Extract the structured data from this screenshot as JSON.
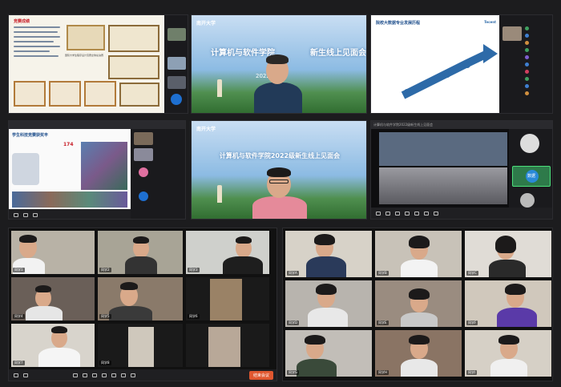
{
  "slide": {
    "school_logo": "南开大学",
    "event_title": "计算机与软件学院2022级新生线上见面会",
    "event_title_partial_left": "计算机与软件学院",
    "event_title_partial_right": "新生线上见面会",
    "event_year_partial": "2022"
  },
  "panel_tl": {
    "header": "竞赛成绩",
    "caption": "国际大学生程序设计竞赛全球总决赛"
  },
  "panel_tr": {
    "chart_title": "院校大数据专业发展历程",
    "brand": "Tecent"
  },
  "panel_ml": {
    "headline": "学生科技竞赛获奖丰",
    "stat": "174"
  },
  "panel_mr": {
    "window_title": "计算机与软件学院2022级新生线上见面会",
    "participant_label": "数据"
  },
  "toolbar": {
    "leave": "结束会议"
  },
  "gallery_left": {
    "names": [
      "同学1",
      "同学2",
      "同学3",
      "同学4",
      "同学5",
      "同学6",
      "同学7",
      "同学8"
    ]
  },
  "gallery_right": {
    "names": [
      "同学A",
      "同学B",
      "同学C",
      "同学D",
      "同学E",
      "同学F",
      "同学G",
      "同学H",
      "同学I",
      "同学J",
      "同学K",
      "同学L"
    ]
  },
  "colors": {
    "accent": "#2d6aa8",
    "leave": "#e0572f",
    "bg": "#1c1c1e"
  }
}
